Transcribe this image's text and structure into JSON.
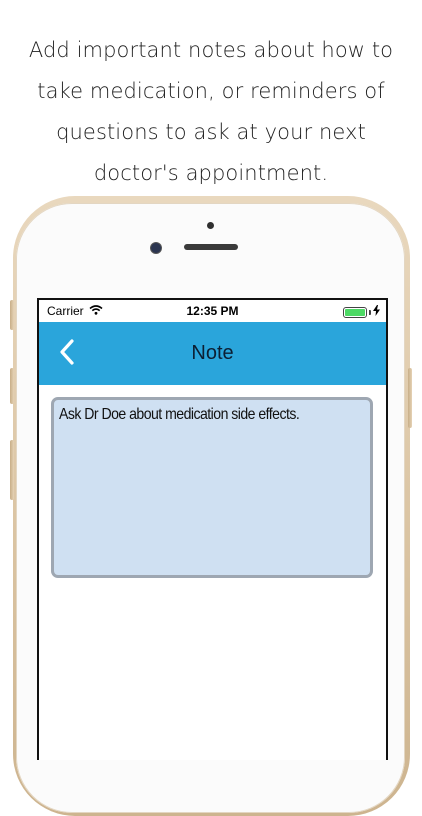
{
  "caption": {
    "lines": [
      "Add important notes about how to",
      "take medication, or reminders of",
      "questions to ask at your next",
      "doctor's appointment."
    ]
  },
  "status_bar": {
    "carrier": "Carrier",
    "time": "12:35 PM",
    "battery_level": 1.0,
    "charging": true
  },
  "nav_bar": {
    "title": "Note",
    "back_icon": "chevron-left-icon"
  },
  "note": {
    "text": "Ask Dr Doe about medication side effects."
  },
  "colors": {
    "nav_bar": "#2aa5db",
    "note_background": "#cfe0f2",
    "note_border": "#9ea7b2",
    "battery": "#4cd964",
    "phone_frame": "#e0cbab"
  }
}
